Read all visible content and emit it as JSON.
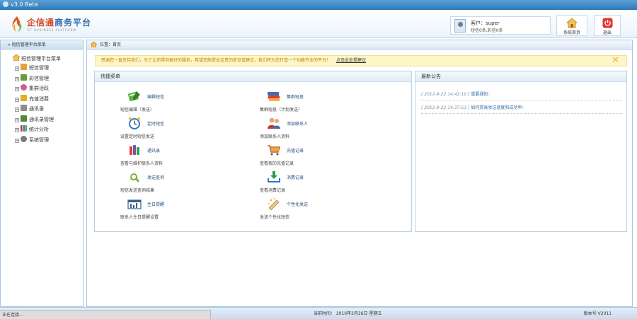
{
  "window": {
    "title": "v3.0  Beta"
  },
  "header": {
    "logo_title_red": "企信通",
    "logo_title_blue": "商务平台",
    "logo_sub": "ET BUSINESS PLATFORM",
    "user_line1": "客户：super",
    "user_line2": "短信0条,彩信0条",
    "home_button": "系统首页",
    "logout_button": "退出"
  },
  "sidebar": {
    "header": "短信管理平台菜单",
    "root": "短信管理平台菜单",
    "items": [
      {
        "label": "短信管理",
        "icon": "sms-icon",
        "color": "#e8a13a"
      },
      {
        "label": "彩信管理",
        "icon": "mms-icon",
        "color": "#6a9a3e"
      },
      {
        "label": "集群活跃",
        "icon": "cluster-icon",
        "color": "#d05a9a"
      },
      {
        "label": "充值消费",
        "icon": "recharge-icon",
        "color": "#e0b020"
      },
      {
        "label": "通讯录",
        "icon": "contacts-icon",
        "color": "#8c8c8c"
      },
      {
        "label": "通讯录管理",
        "icon": "address-book-icon",
        "color": "#4f8a3c"
      },
      {
        "label": "统计分析",
        "icon": "chart-icon",
        "color": "#c0392b"
      },
      {
        "label": "系统管理",
        "icon": "gear-icon",
        "color": "#7a7a7a"
      }
    ]
  },
  "breadcrumb": {
    "text": "位置：首页"
  },
  "notice": {
    "text": "感谢您一直支持我们，为了让你得到更好的服务，希望您能提出宝贵的意见或建议，我们将为您打造一个功能齐全的平台！",
    "link": "点击此处提建议"
  },
  "quick_menu": {
    "title": "快捷菜单",
    "items": [
      {
        "label": "编辑短信",
        "desc": "短信编辑（发送）",
        "icon": "edit-sms-icon",
        "color": "#4a9a3a"
      },
      {
        "label": "集群短息",
        "desc": "集群短息（计划发送）",
        "icon": "cluster-sms-icon",
        "color": "#3a6fb0"
      },
      {
        "label": "定时短信",
        "desc": "设置定时短信发送",
        "icon": "clock-icon",
        "color": "#2b7bc9"
      },
      {
        "label": "添加联系人",
        "desc": "添加联系人资料",
        "icon": "add-contact-icon",
        "color": "#c0392b"
      },
      {
        "label": "通讯录",
        "desc": "查看与维护联系人资料",
        "icon": "address-book-icon",
        "color": "#7b4fb0"
      },
      {
        "label": "充值记录",
        "desc": "查看我的充值记录",
        "icon": "cart-icon",
        "color": "#d07a1e"
      },
      {
        "label": "发送查询",
        "desc": "短信发送查询结果",
        "icon": "search-icon",
        "color": "#5ea83a"
      },
      {
        "label": "消费记录",
        "desc": "查看消费记录",
        "icon": "download-icon",
        "color": "#2e9d4e"
      },
      {
        "label": "生日提醒",
        "desc": "联系人生日提醒设置",
        "icon": "calendar-icon",
        "color": "#3a5f8c"
      },
      {
        "label": "个性化发送",
        "desc": "发送个性化短信",
        "icon": "personalize-icon",
        "color": "#c89a3a"
      }
    ]
  },
  "announcements": {
    "title": "最新公告",
    "items": [
      {
        "date": "[ 2012-9-22 14:42:10 ]",
        "title": "重要通知："
      },
      {
        "date": "[ 2012-9-22 14:37:53 ]",
        "title": "如何提高发送速度和成功率："
      }
    ]
  },
  "statusbar": {
    "loading": "正在连接...",
    "time": "当前时间：  2016年2月26日 星期五",
    "version": "版本号:V2011"
  }
}
